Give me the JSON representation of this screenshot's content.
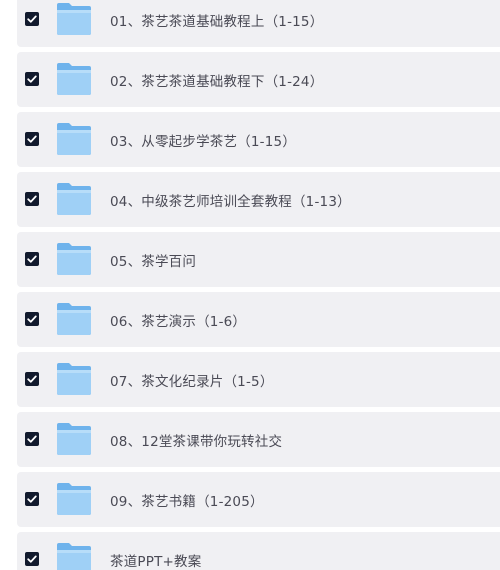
{
  "folders": [
    {
      "name": "01、茶艺茶道基础教程上（1-15）",
      "checked": true,
      "icon": "folder-icon"
    },
    {
      "name": "02、茶艺茶道基础教程下（1-24）",
      "checked": true,
      "icon": "folder-icon"
    },
    {
      "name": "03、从零起步学茶艺（1-15）",
      "checked": true,
      "icon": "folder-icon"
    },
    {
      "name": "04、中级茶艺师培训全套教程（1-13）",
      "checked": true,
      "icon": "folder-icon"
    },
    {
      "name": "05、茶学百问",
      "checked": true,
      "icon": "folder-icon"
    },
    {
      "name": "06、茶艺演示（1-6）",
      "checked": true,
      "icon": "folder-icon"
    },
    {
      "name": "07、茶文化纪录片（1-5）",
      "checked": true,
      "icon": "folder-icon"
    },
    {
      "name": "08、12堂茶课带你玩转社交",
      "checked": true,
      "icon": "folder-icon"
    },
    {
      "name": "09、茶艺书籍（1-205）",
      "checked": true,
      "icon": "folder-icon"
    },
    {
      "name": "茶道PPT+教案",
      "checked": true,
      "icon": "folder-icon"
    }
  ],
  "colors": {
    "row_bg": "#f0f0f3",
    "checkbox": "#121a2d",
    "folder_light": "#9fd0f6",
    "folder_dark": "#6fb3ec",
    "text": "#4a4a55"
  }
}
